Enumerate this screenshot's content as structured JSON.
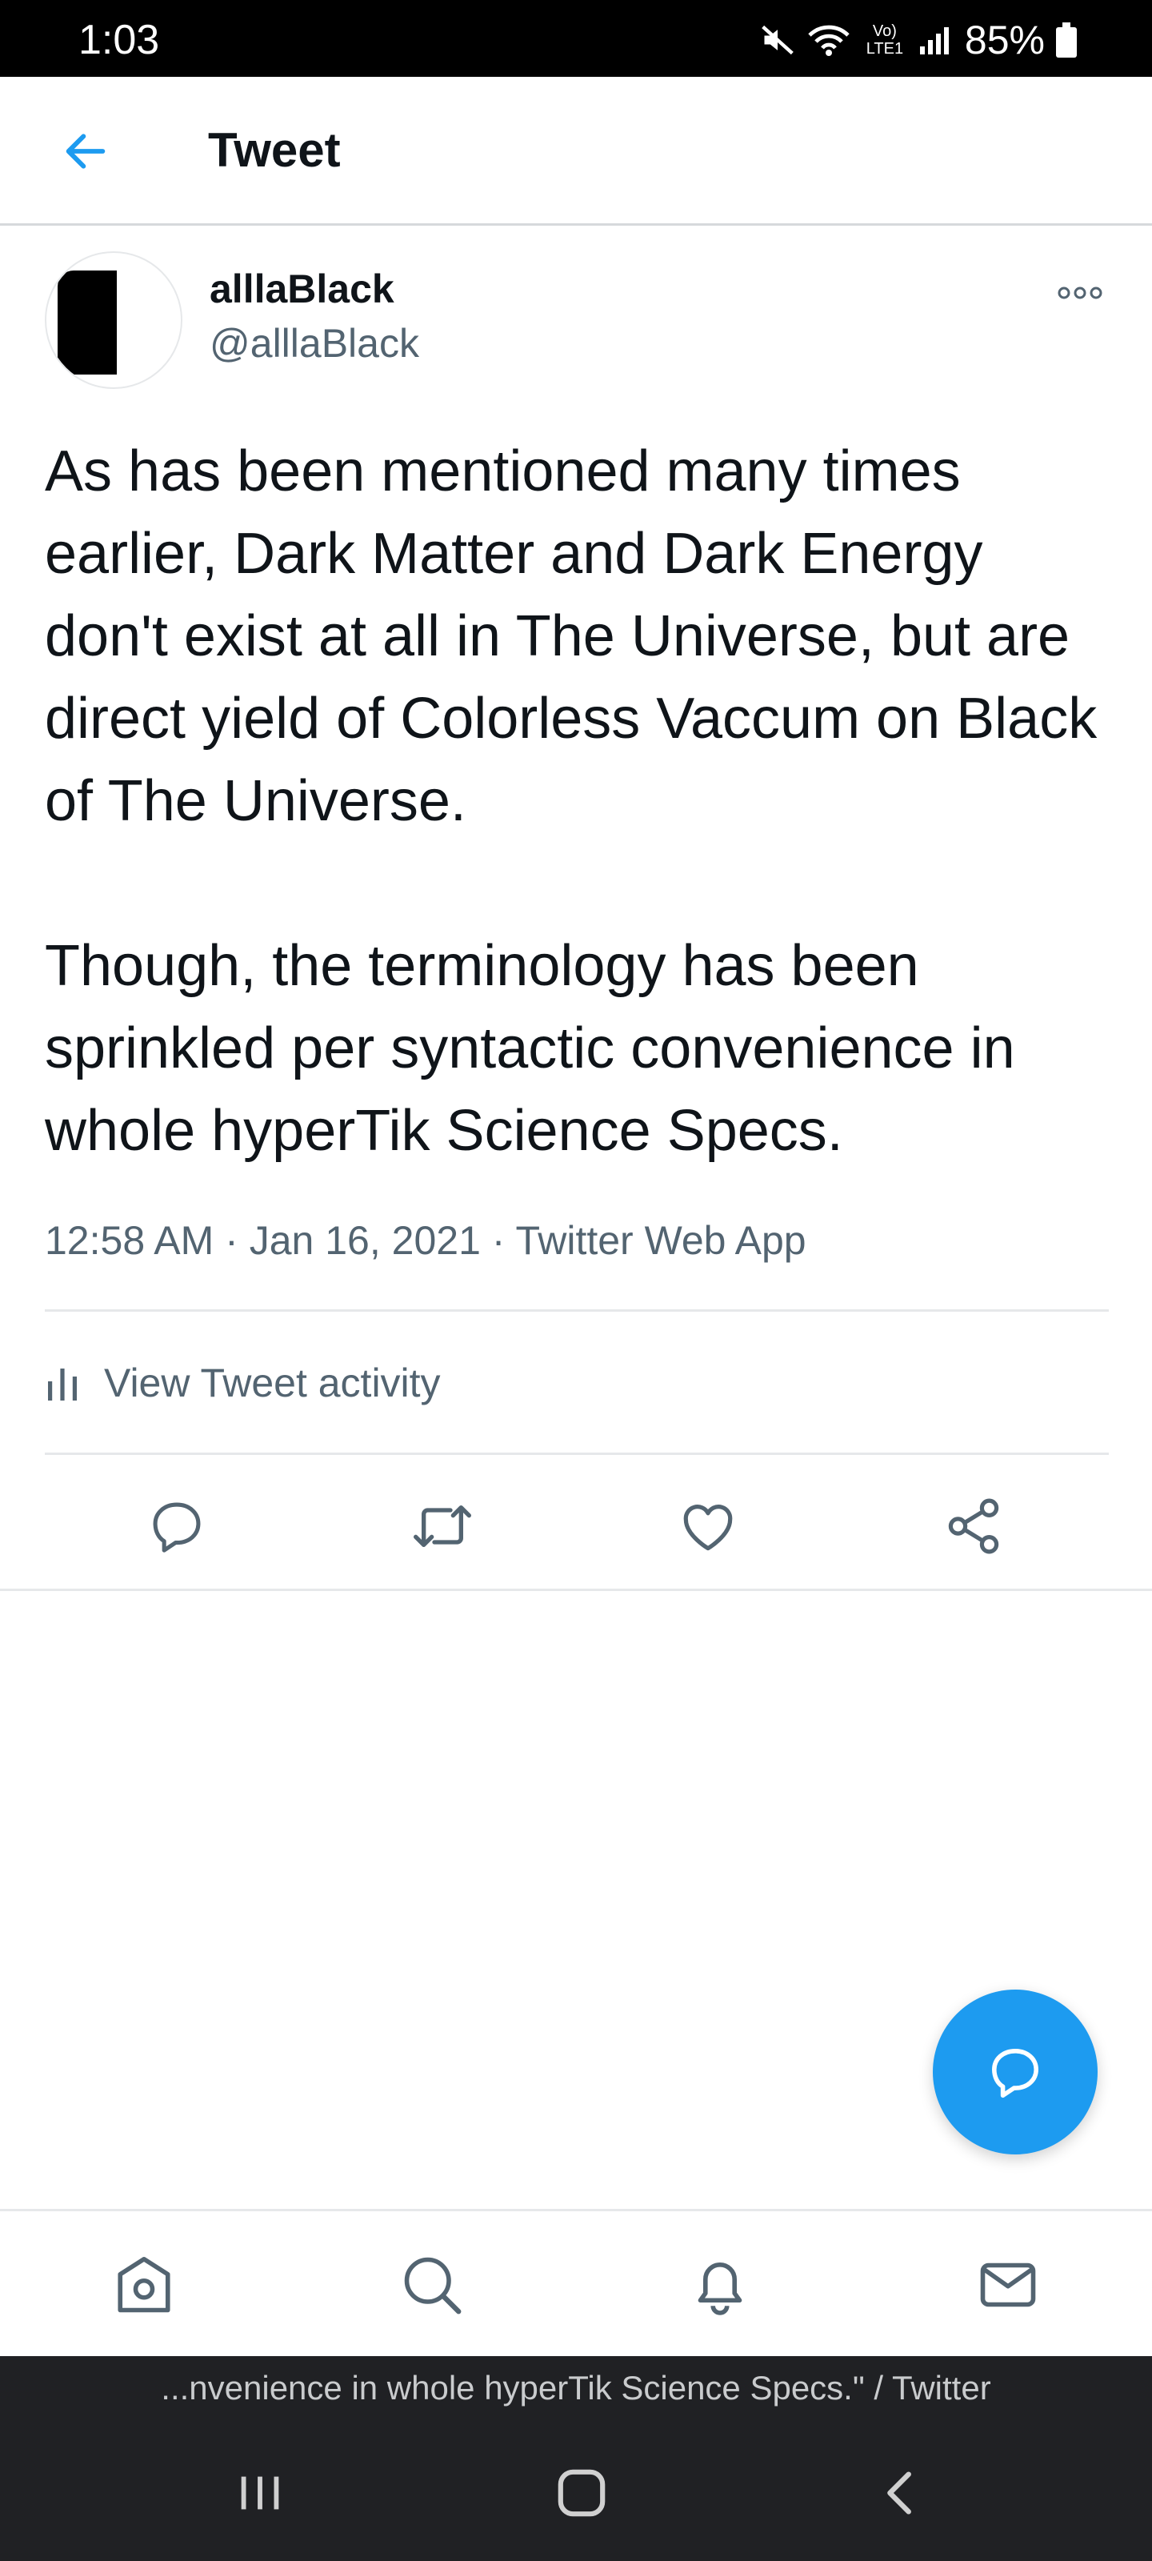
{
  "status_bar": {
    "time": "1:03",
    "battery": "85%",
    "network_label": "Vo) LTE1"
  },
  "header": {
    "title": "Tweet"
  },
  "tweet": {
    "display_name": "alllaBlack",
    "handle": "@alllaBlack",
    "text": "As has been mentioned many times earlier, Dark Matter and Dark Energy don't exist at all in The Universe, but are direct yield of Colorless Vaccum on Black of The Universe.\n\nThough, the terminology has been sprinkled per syntactic convenience in whole hyperTik Science Specs.",
    "time": "12:58 AM",
    "date": "Jan 16, 2021",
    "source": "Twitter Web App",
    "separator": "·"
  },
  "activity": {
    "label": "View Tweet activity"
  },
  "actions": [
    "reply-icon",
    "retweet-icon",
    "like-icon",
    "share-icon"
  ],
  "bottom_nav": [
    "home-icon",
    "search-icon",
    "notifications-icon",
    "messages-icon"
  ],
  "window_title": "...nvenience in whole hyperTik Science Specs.\" / Twitter",
  "colors": {
    "accent": "#1d9bf0",
    "text_primary": "#0f1419",
    "text_secondary": "#536471",
    "divider": "#e6e8ea"
  }
}
